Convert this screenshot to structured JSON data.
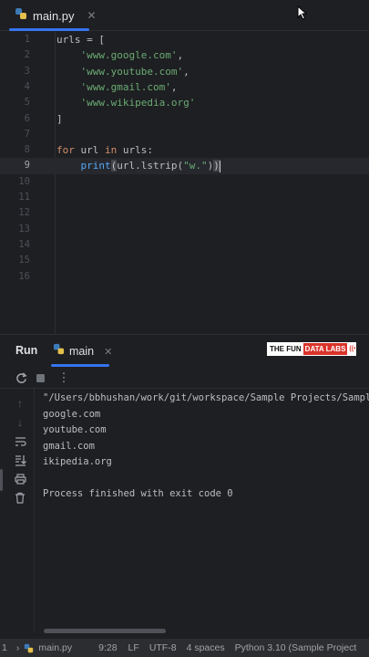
{
  "editor": {
    "tab": {
      "label": "main.py",
      "close": "✕"
    },
    "lines": [
      {
        "num": "1",
        "tokens": [
          {
            "t": "urls = [",
            "c": "plain"
          }
        ]
      },
      {
        "num": "2",
        "tokens": [
          {
            "t": "    ",
            "c": "plain"
          },
          {
            "t": "'www.google.com'",
            "c": "str"
          },
          {
            "t": ",",
            "c": "plain"
          }
        ]
      },
      {
        "num": "3",
        "tokens": [
          {
            "t": "    ",
            "c": "plain"
          },
          {
            "t": "'www.youtube.com'",
            "c": "str"
          },
          {
            "t": ",",
            "c": "plain"
          }
        ]
      },
      {
        "num": "4",
        "tokens": [
          {
            "t": "    ",
            "c": "plain"
          },
          {
            "t": "'www.gmail.com'",
            "c": "str"
          },
          {
            "t": ",",
            "c": "plain"
          }
        ]
      },
      {
        "num": "5",
        "tokens": [
          {
            "t": "    ",
            "c": "plain"
          },
          {
            "t": "'www.wikipedia.org'",
            "c": "str"
          }
        ]
      },
      {
        "num": "6",
        "tokens": [
          {
            "t": "]",
            "c": "plain"
          }
        ]
      },
      {
        "num": "7",
        "tokens": []
      },
      {
        "num": "8",
        "tokens": [
          {
            "t": "for",
            "c": "kw"
          },
          {
            "t": " url ",
            "c": "plain"
          },
          {
            "t": "in",
            "c": "kw"
          },
          {
            "t": " urls:",
            "c": "plain"
          }
        ]
      },
      {
        "num": "9",
        "current": true,
        "tokens": [
          {
            "t": "    ",
            "c": "plain"
          },
          {
            "t": "print",
            "c": "fn"
          },
          {
            "t": "(",
            "c": "paren"
          },
          {
            "t": "url.lstrip(",
            "c": "plain"
          },
          {
            "t": "\"w.\"",
            "c": "str"
          },
          {
            "t": ")",
            "c": "plain"
          },
          {
            "t": ")",
            "c": "paren"
          }
        ]
      },
      {
        "num": "10",
        "tokens": []
      },
      {
        "num": "11",
        "tokens": []
      },
      {
        "num": "12",
        "tokens": []
      },
      {
        "num": "13",
        "tokens": []
      },
      {
        "num": "14",
        "tokens": []
      },
      {
        "num": "15",
        "tokens": []
      },
      {
        "num": "16",
        "tokens": []
      }
    ]
  },
  "run_panel": {
    "title": "Run",
    "tab_label": "main",
    "tab_close": "✕",
    "logo": {
      "part1": "THE FUN",
      "part2": "DATA LABS",
      "part3": "((•))"
    },
    "console_lines": [
      "\"/Users/bbhushan/work/git/workspace/Sample Projects/Sample",
      "google.com",
      "youtube.com",
      "gmail.com",
      "ikipedia.org",
      "",
      "Process finished with exit code 0"
    ]
  },
  "status_bar": {
    "items": [
      "1",
      "›",
      "main.py",
      "9:28",
      "LF",
      "UTF-8",
      "4 spaces",
      "Python 3.10 (Sample Project"
    ]
  },
  "colors": {
    "background": "#1e1f22",
    "accent": "#3574f0",
    "keyword": "#cf8e6d",
    "string": "#6aab73",
    "function": "#56a8f5"
  }
}
